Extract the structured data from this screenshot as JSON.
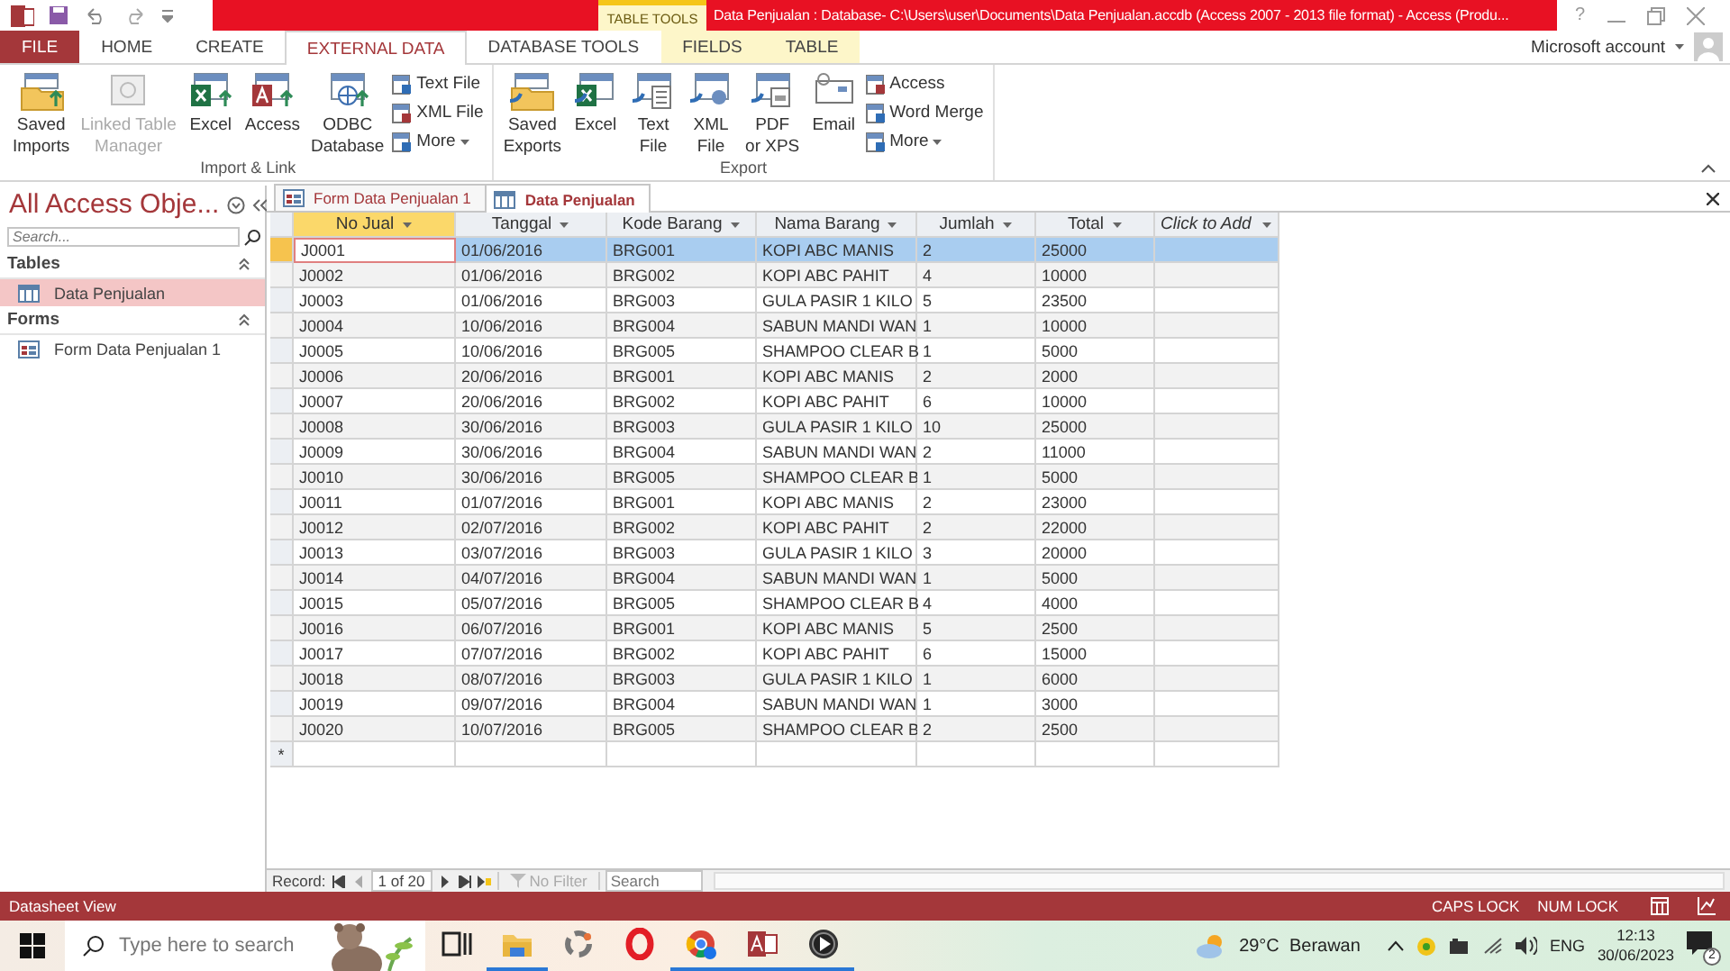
{
  "title_bar": {
    "help": "?",
    "context_tab": "TABLE TOOLS",
    "title": "Data Penjualan : Database- C:\\Users\\user\\Documents\\Data Penjualan.accdb (Access 2007 - 2013 file format) -  Access (Produ..."
  },
  "ribbon_tabs": [
    {
      "label": "FILE",
      "kind": "file",
      "selected": false
    },
    {
      "label": "HOME",
      "kind": "normal",
      "selected": false
    },
    {
      "label": "CREATE",
      "kind": "normal",
      "selected": false
    },
    {
      "label": "EXTERNAL DATA",
      "kind": "normal",
      "selected": true
    },
    {
      "label": "DATABASE TOOLS",
      "kind": "normal",
      "selected": false
    },
    {
      "label": "FIELDS",
      "kind": "contextual",
      "selected": false
    },
    {
      "label": "TABLE",
      "kind": "contextual",
      "selected": false
    }
  ],
  "account": "Microsoft account",
  "ribbon_groups": [
    {
      "label": "Import & Link",
      "buttons": [
        {
          "label": "Saved\nImports",
          "kind": "large",
          "disabled": false
        },
        {
          "label": "Linked Table\nManager",
          "kind": "large",
          "disabled": true
        },
        {
          "label": "Excel",
          "kind": "large",
          "disabled": false
        },
        {
          "label": "Access",
          "kind": "large",
          "disabled": false
        },
        {
          "label": "ODBC\nDatabase",
          "kind": "large",
          "disabled": false
        },
        {
          "label": "Text File",
          "kind": "small",
          "disabled": false
        },
        {
          "label": "XML File",
          "kind": "small",
          "disabled": false
        },
        {
          "label": "More",
          "kind": "menu",
          "disabled": false
        }
      ]
    },
    {
      "label": "Export",
      "buttons": [
        {
          "label": "Saved\nExports",
          "kind": "large",
          "disabled": false
        },
        {
          "label": "Excel",
          "kind": "large",
          "disabled": false
        },
        {
          "label": "Text\nFile",
          "kind": "large",
          "disabled": false
        },
        {
          "label": "XML\nFile",
          "kind": "large",
          "disabled": false
        },
        {
          "label": "PDF\nor XPS",
          "kind": "large",
          "disabled": false
        },
        {
          "label": "Email",
          "kind": "large",
          "disabled": false
        },
        {
          "label": "Access",
          "kind": "small",
          "disabled": false
        },
        {
          "label": "Word Merge",
          "kind": "small",
          "disabled": false
        },
        {
          "label": "More",
          "kind": "menu",
          "disabled": false
        }
      ]
    }
  ],
  "nav_pane": {
    "title": "All Access Obje...",
    "search": {
      "placeholder": "Search..."
    },
    "groups": [
      {
        "label": "Tables",
        "kind": "table",
        "items": [
          {
            "label": "Data Penjualan",
            "selected": true
          }
        ]
      },
      {
        "label": "Forms",
        "kind": "form",
        "items": [
          {
            "label": "Form Data Penjualan 1",
            "selected": false
          }
        ]
      }
    ]
  },
  "document_tabs": [
    {
      "label": "Form Data Penjualan 1",
      "kind": "form",
      "selected": false
    },
    {
      "label": "Data Penjualan",
      "kind": "table",
      "selected": true
    }
  ],
  "datasheet": {
    "columns": [
      {
        "label": "No Jual",
        "kind": "field",
        "selected": true
      },
      {
        "label": "Tanggal",
        "kind": "field",
        "selected": false
      },
      {
        "label": "Kode Barang",
        "kind": "field",
        "selected": false
      },
      {
        "label": "Nama Barang",
        "kind": "field",
        "selected": false
      },
      {
        "label": "Jumlah",
        "kind": "field",
        "selected": false
      },
      {
        "label": "Total",
        "kind": "field",
        "selected": false
      },
      {
        "label": "Click to Add",
        "kind": "add",
        "selected": false
      }
    ],
    "rows": [
      {
        "selected": true,
        "cells": [
          "J0001",
          "01/06/2016",
          "BRG001",
          "KOPI ABC MANIS",
          "2",
          "25000"
        ]
      },
      {
        "selected": false,
        "cells": [
          "J0002",
          "01/06/2016",
          "BRG002",
          "KOPI ABC PAHIT",
          "4",
          "10000"
        ]
      },
      {
        "selected": false,
        "cells": [
          "J0003",
          "01/06/2016",
          "BRG003",
          "GULA PASIR 1 KILO",
          "5",
          "23500"
        ]
      },
      {
        "selected": false,
        "cells": [
          "J0004",
          "10/06/2016",
          "BRG004",
          "SABUN MANDI WAN",
          "1",
          "10000"
        ]
      },
      {
        "selected": false,
        "cells": [
          "J0005",
          "10/06/2016",
          "BRG005",
          "SHAMPOO CLEAR B",
          "1",
          "5000"
        ]
      },
      {
        "selected": false,
        "cells": [
          "J0006",
          "20/06/2016",
          "BRG001",
          "KOPI ABC MANIS",
          "2",
          "2000"
        ]
      },
      {
        "selected": false,
        "cells": [
          "J0007",
          "20/06/2016",
          "BRG002",
          "KOPI ABC PAHIT",
          "6",
          "10000"
        ]
      },
      {
        "selected": false,
        "cells": [
          "J0008",
          "30/06/2016",
          "BRG003",
          "GULA PASIR 1 KILO",
          "10",
          "25000"
        ]
      },
      {
        "selected": false,
        "cells": [
          "J0009",
          "30/06/2016",
          "BRG004",
          "SABUN MANDI WAN",
          "2",
          "11000"
        ]
      },
      {
        "selected": false,
        "cells": [
          "J0010",
          "30/06/2016",
          "BRG005",
          "SHAMPOO CLEAR B",
          "1",
          "5000"
        ]
      },
      {
        "selected": false,
        "cells": [
          "J0011",
          "01/07/2016",
          "BRG001",
          "KOPI ABC MANIS",
          "2",
          "23000"
        ]
      },
      {
        "selected": false,
        "cells": [
          "J0012",
          "02/07/2016",
          "BRG002",
          "KOPI ABC PAHIT",
          "2",
          "22000"
        ]
      },
      {
        "selected": false,
        "cells": [
          "J0013",
          "03/07/2016",
          "BRG003",
          "GULA PASIR 1 KILO",
          "3",
          "20000"
        ]
      },
      {
        "selected": false,
        "cells": [
          "J0014",
          "04/07/2016",
          "BRG004",
          "SABUN MANDI WAN",
          "1",
          "5000"
        ]
      },
      {
        "selected": false,
        "cells": [
          "J0015",
          "05/07/2016",
          "BRG005",
          "SHAMPOO CLEAR B",
          "4",
          "4000"
        ]
      },
      {
        "selected": false,
        "cells": [
          "J0016",
          "06/07/2016",
          "BRG001",
          "KOPI ABC MANIS",
          "5",
          "2500"
        ]
      },
      {
        "selected": false,
        "cells": [
          "J0017",
          "07/07/2016",
          "BRG002",
          "KOPI ABC PAHIT",
          "6",
          "15000"
        ]
      },
      {
        "selected": false,
        "cells": [
          "J0018",
          "08/07/2016",
          "BRG003",
          "GULA PASIR 1 KILO",
          "1",
          "6000"
        ]
      },
      {
        "selected": false,
        "cells": [
          "J0019",
          "09/07/2016",
          "BRG004",
          "SABUN MANDI WAN",
          "1",
          "3000"
        ]
      },
      {
        "selected": false,
        "cells": [
          "J0020",
          "10/07/2016",
          "BRG005",
          "SHAMPOO CLEAR B",
          "2",
          "2500"
        ]
      }
    ],
    "new_row_marker": "*"
  },
  "record_bar": {
    "label": "Record:",
    "position": "1 of 20",
    "filter": {
      "label": "No Filter",
      "disabled": true
    },
    "search": {
      "placeholder": "Search"
    }
  },
  "status_bar": {
    "view": "Datasheet View",
    "indicators": [
      "CAPS LOCK",
      "NUM LOCK"
    ]
  },
  "taskbar": {
    "search": {
      "placeholder": "Type here to search"
    },
    "weather": "29°C  Berawan",
    "language": "ENG",
    "time": "12:13",
    "date": "30/06/2023",
    "notifications": "2"
  }
}
